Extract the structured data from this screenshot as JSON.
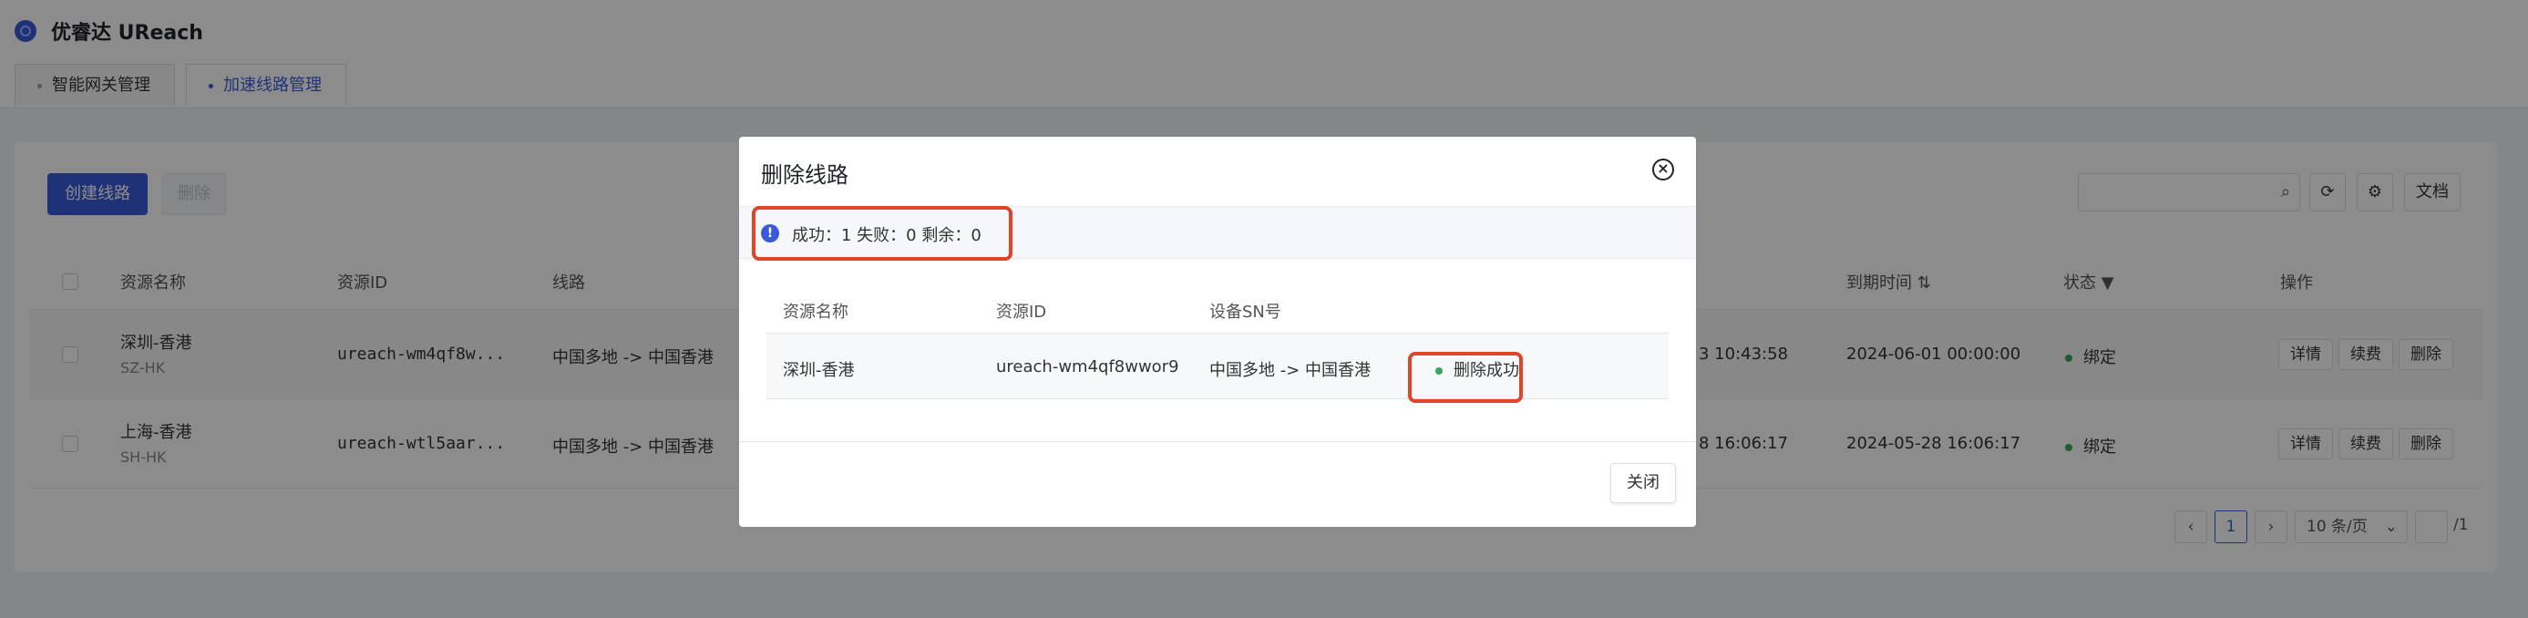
{
  "app": {
    "title": "优睿达 UReach"
  },
  "tabs": [
    {
      "label": "智能网关管理"
    },
    {
      "label": "加速线路管理"
    }
  ],
  "toolbar": {
    "create_label": "创建线路",
    "delete_label": "删除",
    "docs_label": "文档"
  },
  "table": {
    "headers": [
      "资源名称",
      "资源ID",
      "线路",
      "到期时间",
      "状态",
      "操作"
    ],
    "rows": [
      {
        "name": "深圳-香港",
        "code": "SZ-HK",
        "id": "ureach-wm4qf8w...",
        "route": "中国多地 -> 中国香港",
        "created": "3 10:43:58",
        "expire": "2024-06-01 00:00:00",
        "status": "绑定"
      },
      {
        "name": "上海-香港",
        "code": "SH-HK",
        "id": "ureach-wtl5aar...",
        "route": "中国多地 -> 中国香港",
        "created": "8 16:06:17",
        "expire": "2024-05-28 16:06:17",
        "status": "绑定"
      }
    ],
    "actions": {
      "detail": "详情",
      "renew": "续费",
      "delete": "删除"
    }
  },
  "pagination": {
    "current": "1",
    "page_size": "10 条/页",
    "total": "/1"
  },
  "modal": {
    "title": "删除线路",
    "summary": "成功：1 失败：0 剩余：0",
    "headers": [
      "资源名称",
      "资源ID",
      "设备SN号"
    ],
    "row": {
      "name": "深圳-香港",
      "id": "ureach-wm4qf8wwor9",
      "sn": "中国多地 -> 中国香港",
      "result": "删除成功"
    },
    "close_label": "关闭"
  }
}
